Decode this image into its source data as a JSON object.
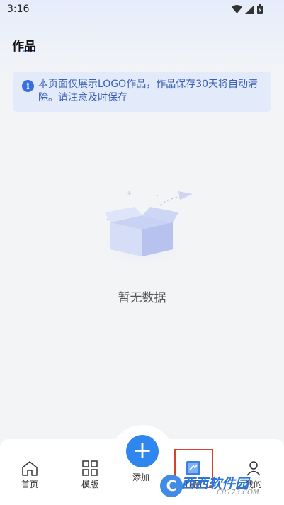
{
  "status_bar": {
    "time": "3:16"
  },
  "header": {
    "title": "作品"
  },
  "notice": {
    "text": "本页面仅展示LOGO作品，作品保存30天将自动清除。请注意及时保存"
  },
  "empty_state": {
    "text": "暂无数据"
  },
  "tabbar": {
    "items": [
      {
        "label": "首页",
        "icon": "home-icon"
      },
      {
        "label": "模版",
        "icon": "grid-icon"
      },
      {
        "label": "添加",
        "icon": "plus-icon"
      },
      {
        "label": "作品",
        "icon": "works-icon"
      },
      {
        "label": "我的",
        "icon": "user-icon"
      }
    ],
    "add_symbol": "+"
  },
  "watermark": {
    "logo": "C",
    "title": "西西软件园",
    "site": "CR173.COM"
  },
  "colors": {
    "accent": "#2f86ef",
    "notice_bg": "#e3ebfb",
    "notice_text": "#3b5fb8",
    "highlight": "#d9412f"
  }
}
